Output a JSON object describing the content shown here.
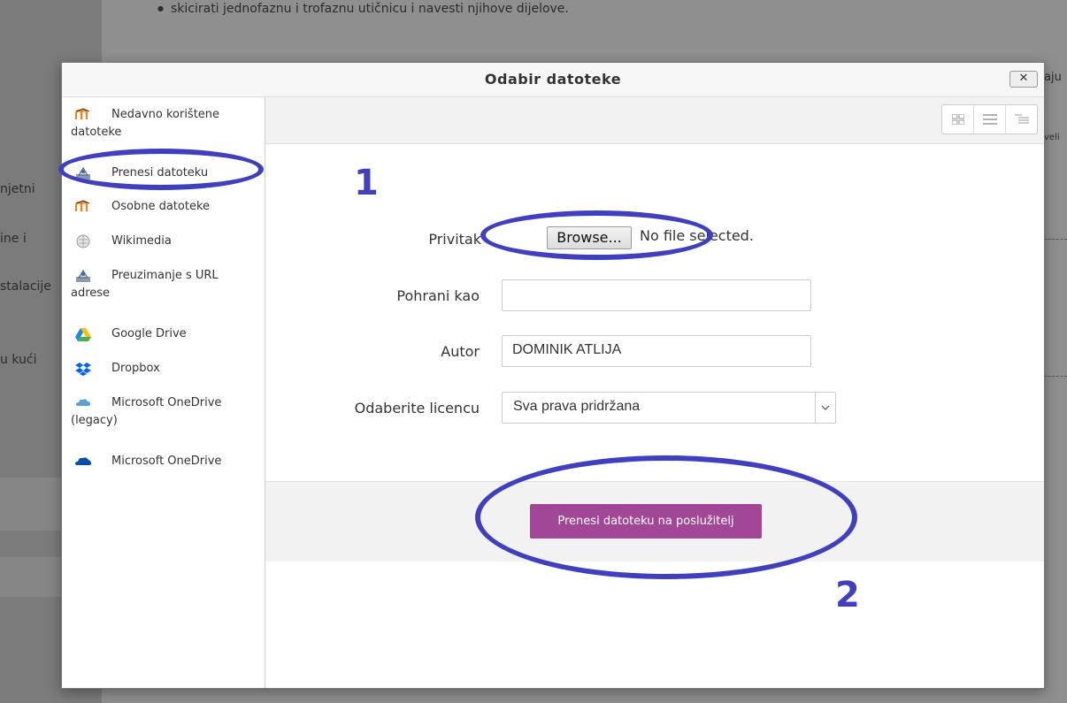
{
  "background": {
    "bullet_text": "skicirati jednofaznu i trofaznu utičnicu i navesti njihove dijelove.",
    "left_fragments": [
      "njetni",
      "ine i",
      "stalacije",
      "u kući"
    ],
    "right_fragments": [
      "aju",
      "veli"
    ]
  },
  "dialog": {
    "title": "Odabir datoteke",
    "close_label": "✕"
  },
  "sidebar": {
    "items": [
      {
        "label": "Nedavno korištene datoteke",
        "icon": "moodle-icon"
      },
      {
        "label": "Prenesi datoteku",
        "icon": "upload-icon"
      },
      {
        "label": "Osobne datoteke",
        "icon": "moodle-icon"
      },
      {
        "label": "Wikimedia",
        "icon": "wikimedia-icon"
      },
      {
        "label": "Preuzimanje s URL adrese",
        "icon": "download-url-icon"
      },
      {
        "label": "Google Drive",
        "icon": "google-drive-icon"
      },
      {
        "label": "Dropbox",
        "icon": "dropbox-icon"
      },
      {
        "label": "Microsoft OneDrive (legacy)",
        "icon": "onedrive-legacy-icon"
      },
      {
        "label": "Microsoft OneDrive",
        "icon": "onedrive-icon"
      }
    ]
  },
  "form": {
    "attachment_label": "Privitak",
    "browse_label": "Browse...",
    "no_file_text": "No file selected.",
    "save_as_label": "Pohrani kao",
    "save_as_value": "",
    "author_label": "Autor",
    "author_value": "DOMINIK ATLIJA",
    "license_label": "Odaberite licencu",
    "license_value": "Sva prava pridržana",
    "upload_button": "Prenesi datoteku na poslužitelj"
  },
  "annotations": {
    "step1": "1",
    "step2": "2",
    "color": "#3f3fbf"
  },
  "colors": {
    "upload_button": "#a24797"
  }
}
